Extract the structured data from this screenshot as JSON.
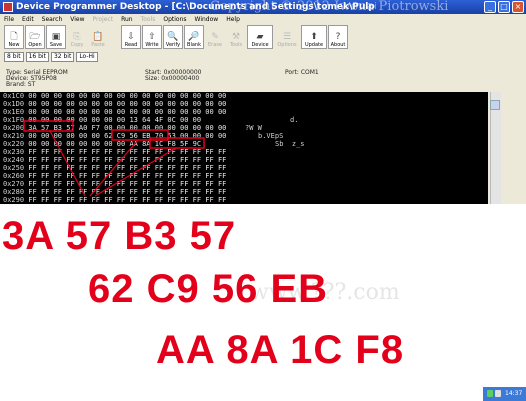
{
  "window": {
    "title": "Device Programmer Desktop - [C:\\Documents and Settings\\tomek\\Pulpit\\SPORC? for emulator]",
    "watermark": "Copyright © 2012 Iwona Piotrowski"
  },
  "menu": [
    "File",
    "Edit",
    "Search",
    "View",
    "Project",
    "Run",
    "Tools",
    "Options",
    "Window",
    "Help"
  ],
  "menu_disabled": [
    "Project",
    "Tools"
  ],
  "toolbar": {
    "new": "New",
    "open": "Open",
    "save": "Save",
    "copy": "Copy",
    "paste": "Paste",
    "read": "Read",
    "write": "Write",
    "verify": "Verify",
    "blank": "Blank",
    "erase": "Erase",
    "tools": "Tools",
    "device": "Device",
    "options": "Options",
    "update": "Update",
    "about": "About"
  },
  "modes": [
    "8 bit",
    "16 bit",
    "32 bit",
    "Lo-Hi"
  ],
  "device_info": {
    "type": "Type: Serial EEPROM",
    "device": "Device: ST95P08",
    "brand": "Brand: ST",
    "start": "Start: 0x00000000",
    "size": "Size: 0x00000400",
    "port": "Port: COM1"
  },
  "hex_rows": [
    {
      "addr": "0x1C0",
      "bytes": "00 00 00 00 00 00 00 00 00 00 00 00 00 00 00 00"
    },
    {
      "addr": "0x1D0",
      "bytes": "00 00 00 00 00 00 00 00 00 00 00 00 00 00 00 00"
    },
    {
      "addr": "0x1E0",
      "bytes": "00 00 00 00 00 00 00 00 00 00 00 00 00 00 00 00"
    },
    {
      "addr": "0x1F0",
      "bytes": "00 00 00 00 00 00 00 00 13 64 4F 0C 00 00"
    },
    {
      "addr": "0x200",
      "bytes": "3A 57 B3 57 A0 F7 00 00 00 00 00 00 00 00 00 00"
    },
    {
      "addr": "0x210",
      "bytes": "00 00 00 00 00 00 62 C9 56 EB 70 53 00 00 00 00"
    },
    {
      "addr": "0x220",
      "bytes": "00 00 00 00 00 00 00 00 AA 8A 1C F8 5F 9C"
    },
    {
      "addr": "0x230",
      "bytes": "FF FF FF FF FF FF FF FF FF FF FF FF FF FF FF FF"
    },
    {
      "addr": "0x240",
      "bytes": "FF FF FF FF FF FF FF FF FF FF FF FF FF FF FF FF"
    },
    {
      "addr": "0x250",
      "bytes": "FF FF FF FF FF FF FF FF FF FF FF FF FF FF FF FF"
    },
    {
      "addr": "0x260",
      "bytes": "FF FF FF FF FF FF FF FF FF FF FF FF FF FF FF FF"
    },
    {
      "addr": "0x270",
      "bytes": "FF FF FF FF FF FF FF FF FF FF FF FF FF FF FF FF"
    },
    {
      "addr": "0x280",
      "bytes": "FF FF FF FF FF FF FF FF FF FF FF FF FF FF FF FF"
    },
    {
      "addr": "0x290",
      "bytes": "FF FF FF FF FF FF FF FF FF FF FF FF FF FF FF FF"
    }
  ],
  "ascii_snippets": [
    "d.",
    "?W W",
    "b.VEpS",
    "Sb  z_s"
  ],
  "annotation": {
    "line1": "3A 57 B3 57",
    "line2": "62 C9 56 EB",
    "line3": "AA 8A 1C F8",
    "color": "#e3001b"
  },
  "watermark_bottom": "www.???.com",
  "taskbar_clock": "14:37"
}
